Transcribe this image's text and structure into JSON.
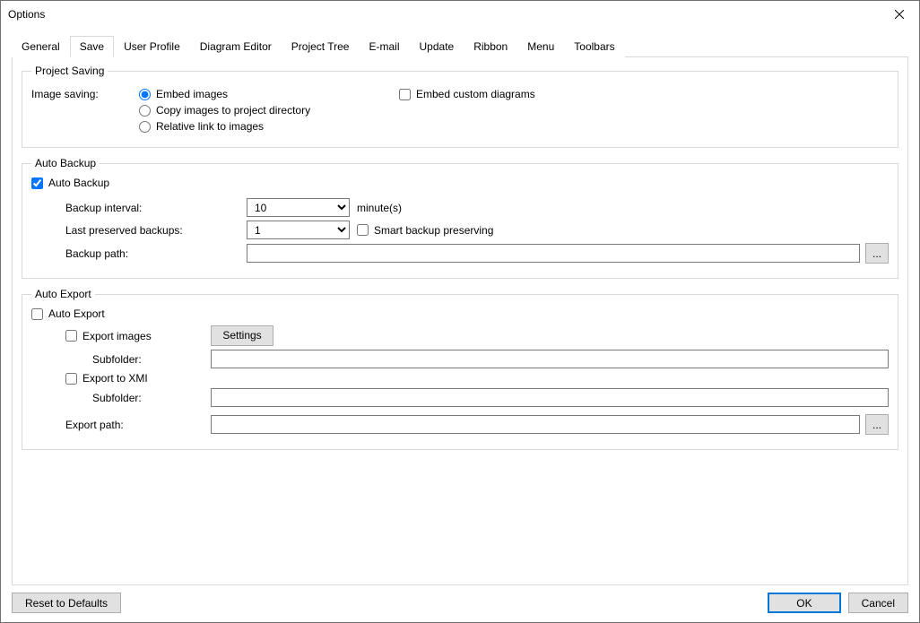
{
  "window": {
    "title": "Options"
  },
  "tabs": [
    "General",
    "Save",
    "User Profile",
    "Diagram Editor",
    "Project Tree",
    "E-mail",
    "Update",
    "Ribbon",
    "Menu",
    "Toolbars"
  ],
  "projectSaving": {
    "legend": "Project Saving",
    "imageSavingLabel": "Image saving:",
    "radios": {
      "embed": "Embed images",
      "copy": "Copy images to project directory",
      "relative": "Relative link to images"
    },
    "embedCustom": "Embed custom diagrams"
  },
  "autoBackup": {
    "legend": "Auto Backup",
    "toggleLabel": "Auto Backup",
    "intervalLabel": "Backup interval:",
    "intervalValue": "10",
    "intervalUnit": "minute(s)",
    "lastPreservedLabel": "Last preserved backups:",
    "lastPreservedValue": "1",
    "smartBackup": "Smart backup preserving",
    "backupPathLabel": "Backup path:",
    "backupPathValue": ""
  },
  "autoExport": {
    "legend": "Auto Export",
    "toggleLabel": "Auto Export",
    "exportImages": "Export images",
    "settingsBtn": "Settings",
    "subfolderLabel": "Subfolder:",
    "subfolder1": "",
    "exportXmi": "Export to XMI",
    "subfolder2": "",
    "exportPathLabel": "Export path:",
    "exportPathValue": ""
  },
  "browseLabel": "...",
  "footer": {
    "reset": "Reset to Defaults",
    "ok": "OK",
    "cancel": "Cancel"
  }
}
